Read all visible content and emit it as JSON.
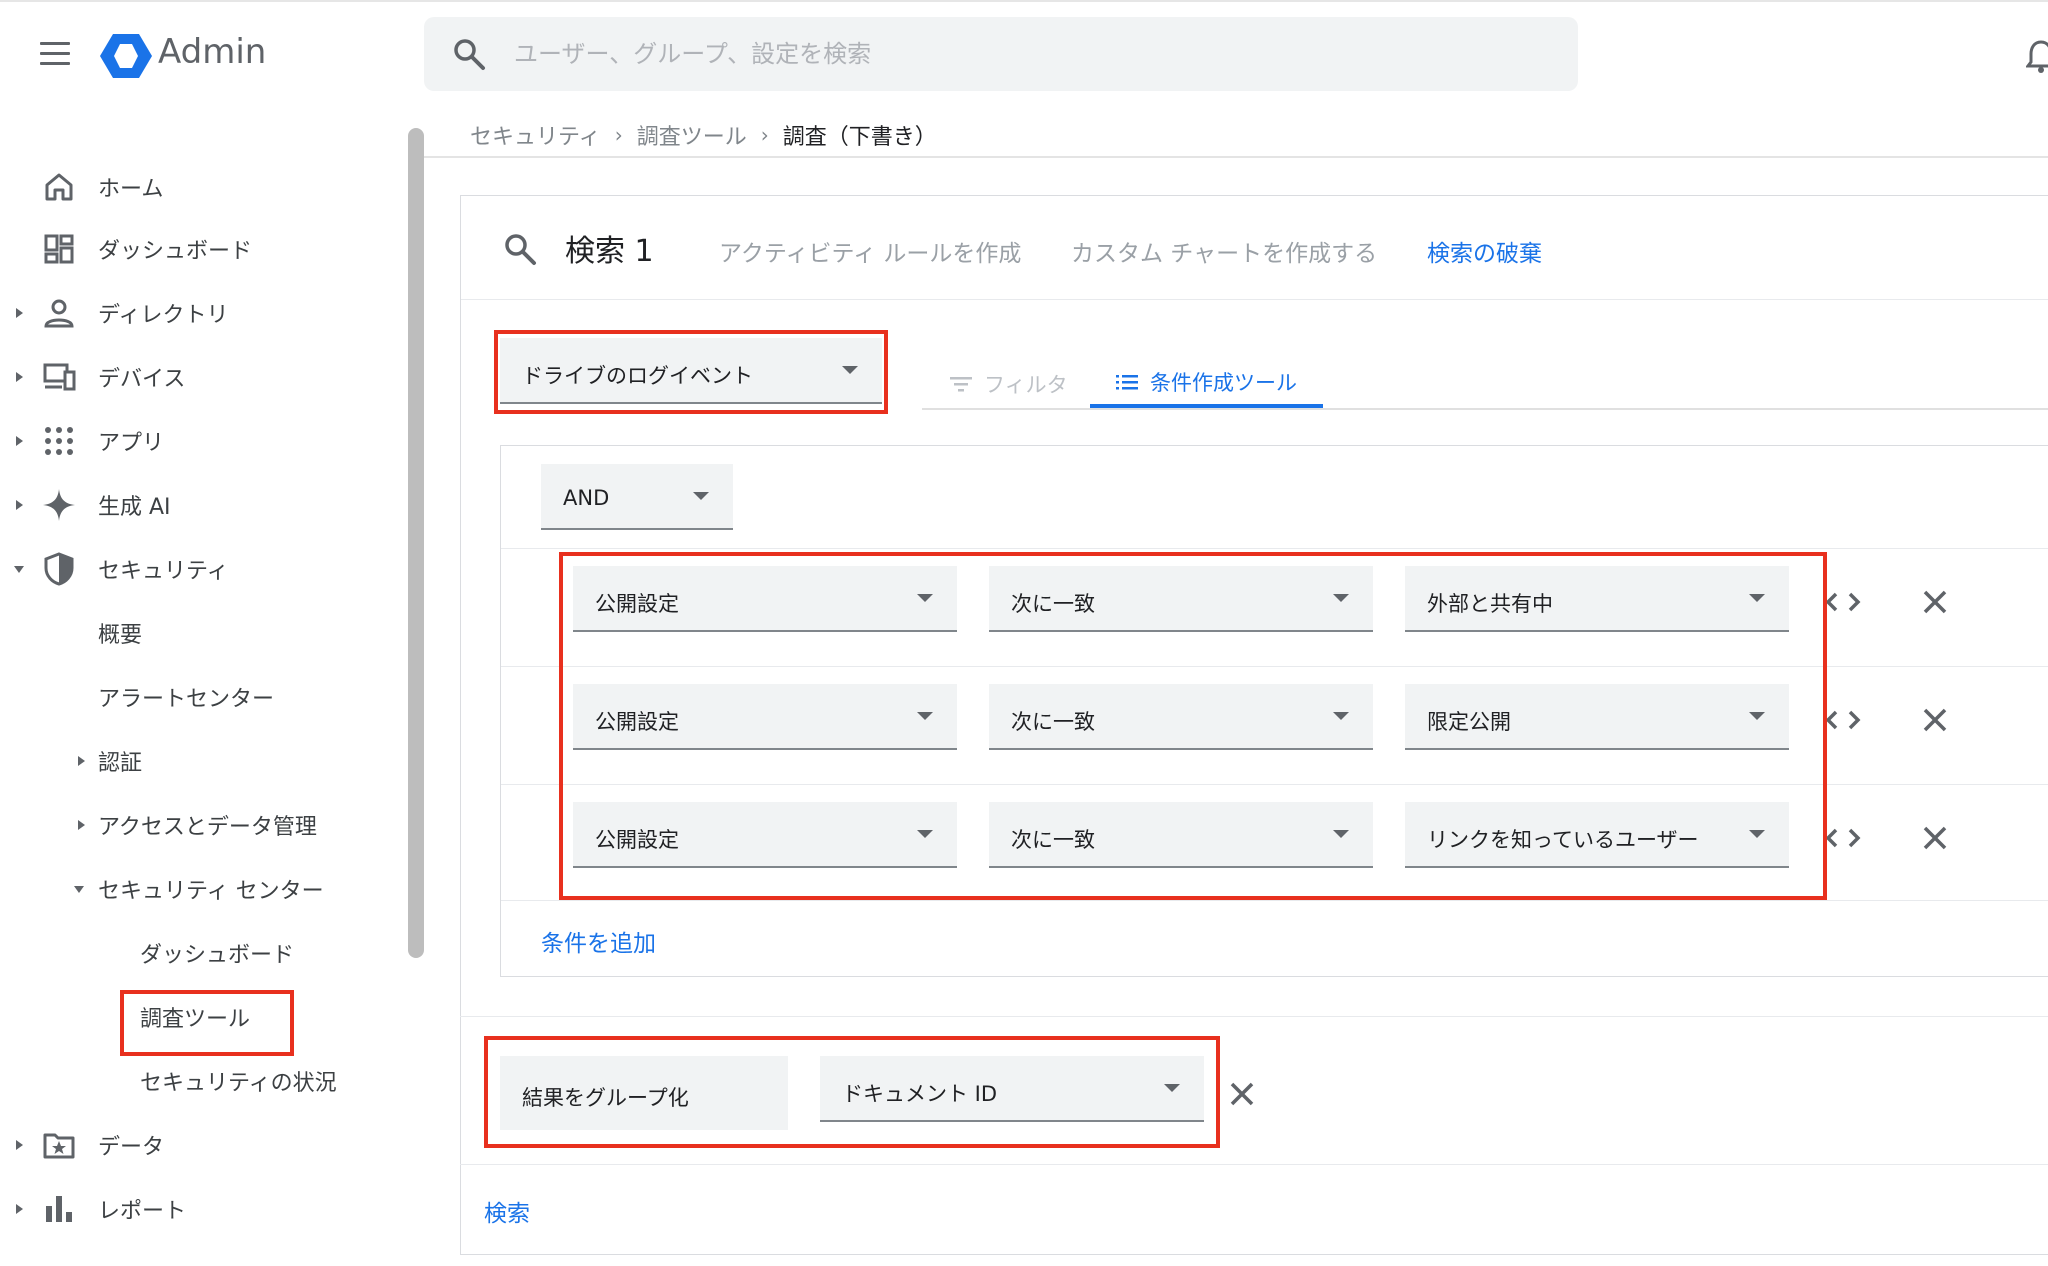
{
  "app": {
    "title": "Admin",
    "brand_color": "#1a73e8",
    "accent_red": "#e8301e"
  },
  "search": {
    "placeholder": "ユーザー、グループ、設定を検索"
  },
  "breadcrumb": [
    "セキュリティ",
    "調査ツール",
    "調査（下書き）"
  ],
  "sidebar": {
    "items": [
      {
        "label": "ホーム",
        "icon": "home-icon"
      },
      {
        "label": "ダッシュボード",
        "icon": "dashboard-icon"
      },
      {
        "label": "ディレクトリ",
        "icon": "person-icon"
      },
      {
        "label": "デバイス",
        "icon": "devices-icon"
      },
      {
        "label": "アプリ",
        "icon": "apps-grid-icon"
      },
      {
        "label": "生成 AI",
        "icon": "sparkle-icon"
      },
      {
        "label": "セキュリティ",
        "icon": "shield-icon"
      },
      {
        "label": "概要"
      },
      {
        "label": "アラートセンター"
      },
      {
        "label": "認証"
      },
      {
        "label": "アクセスとデータ管理"
      },
      {
        "label": "セキュリティ センター"
      },
      {
        "label": "ダッシュボード"
      },
      {
        "label": "調査ツール"
      },
      {
        "label": "セキュリティの状況"
      },
      {
        "label": "データ",
        "icon": "folder-star-icon"
      },
      {
        "label": "レポート",
        "icon": "bar-chart-icon"
      }
    ]
  },
  "card": {
    "title": "検索 1",
    "links": [
      "アクティビティ ルールを作成",
      "カスタム チャートを作成する",
      "検索の破棄"
    ]
  },
  "data_source": "ドライブのログイベント",
  "tabs": [
    "フィルタ",
    "条件作成ツール"
  ],
  "builder": {
    "operator": "AND",
    "conditions": [
      {
        "attribute": "公開設定",
        "op": "次に一致",
        "value": "外部と共有中"
      },
      {
        "attribute": "公開設定",
        "op": "次に一致",
        "value": "限定公開"
      },
      {
        "attribute": "公開設定",
        "op": "次に一致",
        "value": "リンクを知っているユーザー"
      }
    ],
    "add_label": "条件を追加"
  },
  "group_by": {
    "label": "結果をグループ化",
    "value": "ドキュメント ID"
  },
  "submit_label": "検索"
}
